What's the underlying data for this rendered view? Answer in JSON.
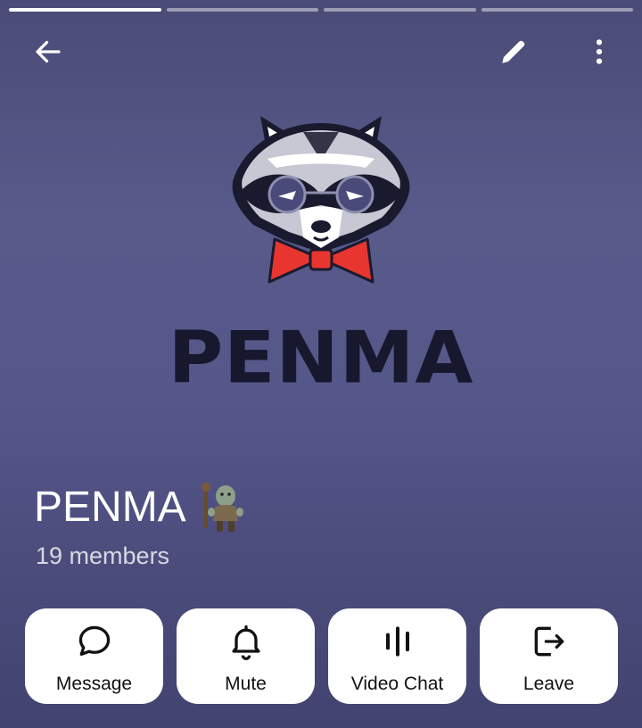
{
  "progress": {
    "segments": 4,
    "active_index": 0
  },
  "header": {
    "back_icon": "arrow-left-icon",
    "edit_icon": "pencil-icon",
    "more_icon": "more-vertical-icon"
  },
  "logo": {
    "wordmark": "PENMA"
  },
  "group": {
    "name": "PENMA",
    "members": "19 members"
  },
  "actions": [
    {
      "label": "Message",
      "icon": "chat-bubble-icon"
    },
    {
      "label": "Mute",
      "icon": "bell-icon"
    },
    {
      "label": "Video Chat",
      "icon": "voice-bars-icon"
    },
    {
      "label": "Leave",
      "icon": "logout-icon"
    }
  ],
  "colors": {
    "background": "#55578a",
    "button_bg": "#ffffff",
    "wordmark": "#17172e",
    "bow_tie": "#e8352f"
  }
}
